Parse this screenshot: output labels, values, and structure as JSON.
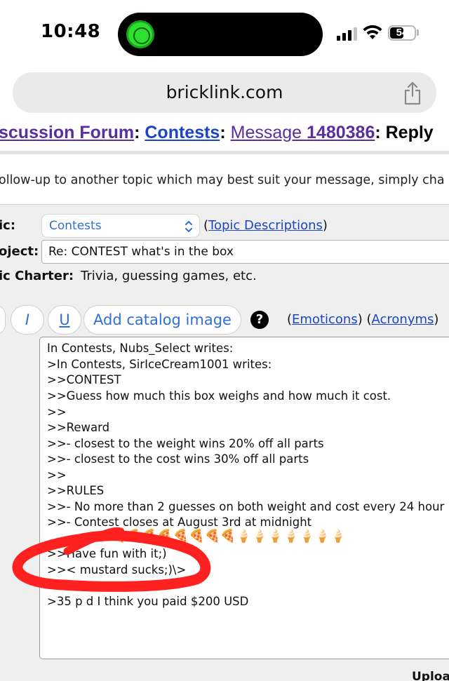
{
  "status_bar": {
    "time": "10:48",
    "battery_level": "54"
  },
  "browser": {
    "address": "bricklink.com"
  },
  "breadcrumb": {
    "forum": "scussion Forum",
    "sep1": ":",
    "category": "Contests",
    "sep2": ":",
    "message_label": "Message",
    "message_id": "1480386",
    "suffix": ": Reply"
  },
  "intro": {
    "text": "ollow-up to another topic which may best suit your message, simply cha"
  },
  "form": {
    "topic_label": "ic:",
    "topic_value": "Contests",
    "topic_desc_open": "(",
    "topic_desc_link": "Topic Descriptions",
    "topic_desc_close": ")",
    "subject_label": "oject:",
    "subject_value": "Re: CONTEST what's in the box",
    "charter_label": "ic Charter:",
    "charter_value": "Trivia, guessing games, etc."
  },
  "toolbar": {
    "italic_label": "I",
    "underline_label": "U",
    "catalog_image_label": "Add catalog image",
    "help_label": "?",
    "emoticons_open": "(",
    "emoticons_link": "Emoticons",
    "between": ") (",
    "acronyms_link": "Acronyms",
    "acronyms_close": ")"
  },
  "message": {
    "lines": [
      "In Contests, Nubs_Select writes:",
      ">In Contests, SirIceCream1001 writes:",
      ">>CONTEST",
      ">>Guess how much this box weighs and how much it cost.",
      ">>",
      ">>Reward",
      ">>- closest to the weight wins 20% off all parts",
      ">>- closest to the cost wins 30% off all parts",
      ">>",
      ">>RULES",
      ">>- No more than 2 guesses on both weight and cost every 24 hour",
      ">>- Contest closes at August 3rd at midnight",
      ">>Have fun with it;)",
      ">>< mustard sucks;)\\>",
      ">35 p          d  I think you paid $200 USD"
    ],
    "emoji_row": "🍕🍕🍕🍕🍕🍕🍕🍕🍦🍦🍦🍦🍦🍦🍦"
  },
  "footer": {
    "upload_label": "Uploa"
  },
  "annotation": {
    "color": "#ff2020"
  }
}
